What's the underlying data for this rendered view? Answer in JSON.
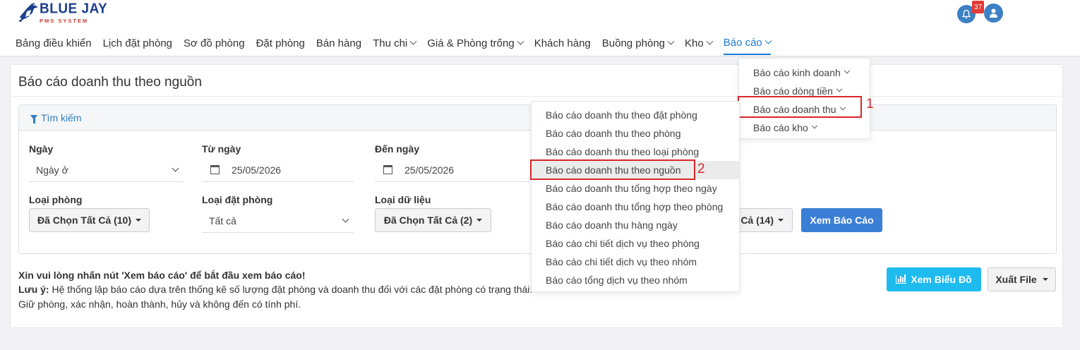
{
  "brand": {
    "name": "BLUE JAY",
    "subtitle": "PMS SYSTEM"
  },
  "nav": {
    "items": [
      {
        "label": "Bảng điều khiển",
        "has_caret": false
      },
      {
        "label": "Lịch đặt phòng",
        "has_caret": false
      },
      {
        "label": "Sơ đồ phòng",
        "has_caret": false
      },
      {
        "label": "Đặt phòng",
        "has_caret": false
      },
      {
        "label": "Bán hàng",
        "has_caret": false
      },
      {
        "label": "Thu chi",
        "has_caret": true
      },
      {
        "label": "Giá & Phòng trống",
        "has_caret": true
      },
      {
        "label": "Khách hàng",
        "has_caret": false
      },
      {
        "label": "Buồng phòng",
        "has_caret": true
      },
      {
        "label": "Kho",
        "has_caret": true
      },
      {
        "label": "Báo cáo",
        "has_caret": true,
        "active": true
      }
    ],
    "accent_color": "#1a7bd6"
  },
  "header": {
    "notification_count": "37",
    "bell_icon": "bell-icon",
    "user_icon": "user-icon"
  },
  "page": {
    "title": "Báo cáo doanh thu theo nguồn"
  },
  "search": {
    "header_label": "Tìm kiếm",
    "fields": {
      "date_type": {
        "label": "Ngày",
        "value": "Ngày ở"
      },
      "from_date": {
        "label": "Từ ngày",
        "value": "25/05/2026"
      },
      "to_date": {
        "label": "Đến ngày",
        "value": "25/05/2026"
      },
      "room_type": {
        "label": "Loại phòng",
        "value": "Đã Chọn Tất Cả (10)"
      },
      "booking_type": {
        "label": "Loại đặt phòng",
        "value": "Tất cả"
      },
      "data_type": {
        "label": "Loại dữ liệu",
        "value": "Đã Chọn Tất Cả (2)"
      },
      "source": {
        "value": "Cả (14)"
      }
    },
    "submit_label": "Xem Báo Cáo"
  },
  "info": {
    "prompt": "Xin vui lòng nhấn nút 'Xem báo cáo' để bắt đầu xem báo cáo!",
    "note_label": "Lưu ý:",
    "note_text": " Hệ thống lập báo cáo dựa trên thống kê số lượng đặt phòng và doanh thu đối với các đặt phòng có trạng thái:",
    "note_line2": "Giữ phòng, xác nhận, hoàn thành, hủy và không đến có tính phí."
  },
  "actions": {
    "chart_label": "Xem Biểu Đồ",
    "export_label": "Xuất File"
  },
  "report_menu": {
    "items": [
      {
        "label": "Báo cáo kinh doanh"
      },
      {
        "label": "Báo cáo dòng tiền"
      },
      {
        "label": "Báo cáo doanh thu"
      },
      {
        "label": "Báo cáo kho"
      }
    ],
    "annotation": "1"
  },
  "revenue_submenu": {
    "items": [
      {
        "label": "Báo cáo doanh thu theo đặt phòng"
      },
      {
        "label": "Báo cáo doanh thu theo phòng"
      },
      {
        "label": "Báo cáo doanh thu theo loại phòng"
      },
      {
        "label": "Báo cáo doanh thu theo nguồn",
        "selected": true
      },
      {
        "label": "Báo cáo doanh thu tổng hợp theo ngày"
      },
      {
        "label": "Báo cáo doanh thu tổng hợp theo phòng"
      },
      {
        "label": "Báo cáo doanh thu hàng ngày"
      },
      {
        "label": "Báo cáo chi tiết dịch vụ theo phòng"
      },
      {
        "label": "Báo cáo chi tiết dịch vụ theo nhóm"
      },
      {
        "label": "Báo cáo tổng dịch vụ theo nhóm"
      }
    ],
    "annotation": "2"
  },
  "colors": {
    "primary": "#3a7fd5",
    "info": "#1ebbef",
    "highlight": "#d9262c",
    "badge": "#e53935"
  }
}
